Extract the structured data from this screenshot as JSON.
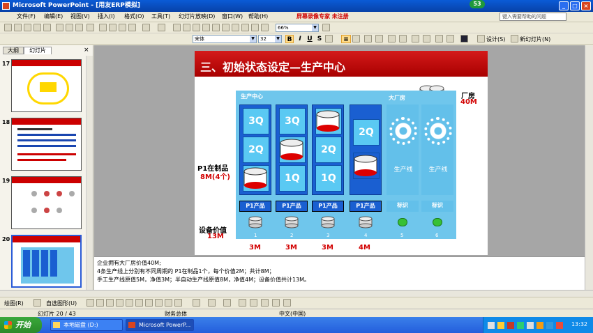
{
  "window": {
    "title": "Microsoft PowerPoint - [用友ERP模拟]",
    "badge": "53"
  },
  "menu": {
    "items": [
      "文件(F)",
      "编辑(E)",
      "视图(V)",
      "插入(I)",
      "格式(O)",
      "工具(T)",
      "幻灯片放映(D)",
      "窗口(W)",
      "帮助(H)"
    ],
    "recorder_text": "屏幕录像专家 未注册",
    "help_placeholder": "键入需要帮助的问题"
  },
  "toolbar": {
    "font_name": "宋体",
    "font_size": "32",
    "zoom": "66%",
    "design_label": "设计(S)",
    "new_slide_label": "新幻灯片(N)"
  },
  "left_pane": {
    "tabs": [
      "大纲",
      "幻灯片"
    ],
    "slides": [
      {
        "num": "17"
      },
      {
        "num": "18"
      },
      {
        "num": "19"
      },
      {
        "num": "20"
      }
    ]
  },
  "slide": {
    "title": "三、初始状态设定—生产中心",
    "panel_label": "生产中心",
    "big_factory_label": "大厂房",
    "factory_label": "厂房",
    "factory_value": "40M",
    "wip_label": "P1在制品",
    "wip_value": "8M(4个)",
    "equipment_label": "设备价值",
    "equipment_value": "13M",
    "lines": [
      {
        "cells": [
          "3Q",
          "2Q"
        ],
        "product": "P1产品",
        "number": "1",
        "value": "3M"
      },
      {
        "cells": [
          "3Q",
          "1Q"
        ],
        "product": "P1产品",
        "number": "2",
        "value": "3M"
      },
      {
        "cells": [
          "2Q",
          "1Q"
        ],
        "product": "P1产品",
        "number": "3",
        "value": "3M"
      },
      {
        "cells": [
          "2Q"
        ],
        "product": "P1产品",
        "number": "4",
        "value": "4M"
      }
    ],
    "empty_lines": [
      {
        "label": "生产线",
        "tag": "标识",
        "number": "5"
      },
      {
        "label": "生产线",
        "tag": "标识",
        "number": "6"
      }
    ]
  },
  "notes": [
    "企业拥有大厂房价值40M;",
    "4条生产线上分别有不同周期的 P1在制品1个，每个价值2M；共计8M；",
    "手工生产线原值5M，净值3M；半自动生产线原值8M，净值4M；设备价值共计13M。"
  ],
  "drawbar": {
    "draw_label": "绘图(R)",
    "autoshape_label": "自选图形(U)"
  },
  "status": {
    "slide_counter": "幻灯片 20 / 43",
    "design_name": "财务总体",
    "language": "中文(中国)"
  },
  "taskbar": {
    "start_label": "开始",
    "items": [
      "本地磁盘 (D:)",
      "Microsoft PowerP..."
    ],
    "clock": "13:32"
  },
  "colors": {
    "title_red": "#c00000",
    "panel_blue": "#6fc6ec",
    "line_blue": "#1a5fd1"
  }
}
